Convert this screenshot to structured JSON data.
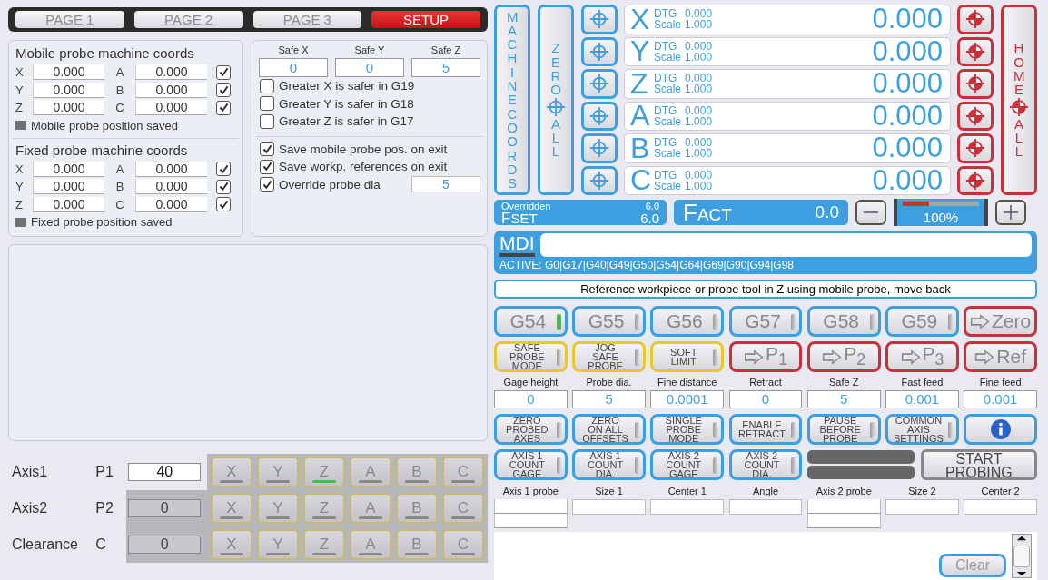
{
  "tabs": [
    {
      "label": "PAGE 1",
      "selected": false
    },
    {
      "label": "PAGE 2",
      "selected": false
    },
    {
      "label": "PAGE 3",
      "selected": false
    },
    {
      "label": "SETUP",
      "selected": true
    }
  ],
  "probe_coords": [
    {
      "title": "Mobile probe machine coords",
      "rows": [
        {
          "axis_1": "X",
          "value_1": "0.000",
          "axis_2": "A",
          "value_2": "0.000",
          "checked": true
        },
        {
          "axis_1": "Y",
          "value_1": "0.000",
          "axis_2": "B",
          "value_2": "0.000",
          "checked": true
        },
        {
          "axis_1": "Z",
          "value_1": "0.000",
          "axis_2": "C",
          "value_2": "0.000",
          "checked": true
        }
      ],
      "saved": {
        "label": "Mobile probe position saved",
        "on": false
      }
    },
    {
      "title": "Fixed probe machine coords",
      "rows": [
        {
          "axis_1": "X",
          "value_1": "0.000",
          "axis_2": "A",
          "value_2": "0.000",
          "checked": true
        },
        {
          "axis_1": "Y",
          "value_1": "0.000",
          "axis_2": "B",
          "value_2": "0.000",
          "checked": true
        },
        {
          "axis_1": "Z",
          "value_1": "0.000",
          "axis_2": "C",
          "value_2": "0.000",
          "checked": true
        }
      ],
      "saved": {
        "label": "Fixed probe position saved",
        "on": false
      }
    }
  ],
  "safe_positions": {
    "fields": [
      {
        "label": "Safe X",
        "value": "0"
      },
      {
        "label": "Safe Y",
        "value": "0"
      },
      {
        "label": "Safe Z",
        "value": "5"
      }
    ],
    "options": [
      {
        "label": "Greater X is safer in G19",
        "checked": false
      },
      {
        "label": "Greater Y is safer in G18",
        "checked": false
      },
      {
        "label": "Greater Z is safer in G17",
        "checked": false
      }
    ],
    "exit_options": [
      {
        "label": "Save mobile probe pos. on exit",
        "checked": true
      },
      {
        "label": "Save workp. references on exit",
        "checked": true
      },
      {
        "label": "Override probe dia",
        "checked": true,
        "value": "5"
      }
    ]
  },
  "axis_selection": [
    {
      "label": "Axis1",
      "param": "P1",
      "value": "40",
      "enabled": true,
      "axes": [
        {
          "letter": "X",
          "selected": false
        },
        {
          "letter": "Y",
          "selected": false
        },
        {
          "letter": "Z",
          "selected": true
        },
        {
          "letter": "A",
          "selected": false
        },
        {
          "letter": "B",
          "selected": false
        },
        {
          "letter": "C",
          "selected": false
        }
      ]
    },
    {
      "label": "Axis2",
      "param": "P2",
      "value": "0",
      "enabled": false,
      "axes": [
        {
          "letter": "X",
          "selected": false
        },
        {
          "letter": "Y",
          "selected": false
        },
        {
          "letter": "Z",
          "selected": false
        },
        {
          "letter": "A",
          "selected": false
        },
        {
          "letter": "B",
          "selected": false
        },
        {
          "letter": "C",
          "selected": false
        }
      ]
    },
    {
      "label": "Clearance",
      "param": "C",
      "value": "0",
      "enabled": false,
      "axes": [
        {
          "letter": "X",
          "selected": false
        },
        {
          "letter": "Y",
          "selected": false
        },
        {
          "letter": "Z",
          "selected": false
        },
        {
          "letter": "A",
          "selected": false
        },
        {
          "letter": "B",
          "selected": false
        },
        {
          "letter": "C",
          "selected": false
        }
      ]
    }
  ],
  "dro": {
    "machine_coords_button": "MACHINE COORDS",
    "zero_all": {
      "top": "ZERO",
      "bottom": "ALL"
    },
    "home_all": {
      "top": "HOME",
      "bottom": "ALL"
    },
    "axes": [
      {
        "letter": "X",
        "dtg_label": "DTG",
        "dtg": "0.000",
        "scale_label": "Scale",
        "scale": "1.000",
        "value": "0.000"
      },
      {
        "letter": "Y",
        "dtg_label": "DTG",
        "dtg": "0.000",
        "scale_label": "Scale",
        "scale": "1.000",
        "value": "0.000"
      },
      {
        "letter": "Z",
        "dtg_label": "DTG",
        "dtg": "0.000",
        "scale_label": "Scale",
        "scale": "1.000",
        "value": "0.000"
      },
      {
        "letter": "A",
        "dtg_label": "DTG",
        "dtg": "0.000",
        "scale_label": "Scale",
        "scale": "1.000",
        "value": "0.000"
      },
      {
        "letter": "B",
        "dtg_label": "DTG",
        "dtg": "0.000",
        "scale_label": "Scale",
        "scale": "1.000",
        "value": "0.000"
      },
      {
        "letter": "C",
        "dtg_label": "DTG",
        "dtg": "0.000",
        "scale_label": "Scale",
        "scale": "1.000",
        "value": "0.000"
      }
    ]
  },
  "feed": {
    "overridden_label": "Overridden",
    "overridden": "6.0",
    "set_label": "FSET",
    "set": "6.0",
    "actual_label": "FACT",
    "actual": "0.0",
    "override": {
      "level": 0.35,
      "reading": "100%"
    }
  },
  "mdi": {
    "label": "MDI",
    "active": "ACTIVE: G0|G17|G40|G49|G50|G54|G64|G69|G90|G94|G98"
  },
  "status": "Reference workpiece or probe tool in Z using mobile probe, move back",
  "work_offsets": [
    {
      "label": "G54",
      "selected": true
    },
    {
      "label": "G55",
      "selected": false
    },
    {
      "label": "G56",
      "selected": false
    },
    {
      "label": "G57",
      "selected": false
    },
    {
      "label": "G58",
      "selected": false
    },
    {
      "label": "G59",
      "selected": false
    }
  ],
  "goto_zero": "Zero",
  "probe_modes": [
    {
      "lines": [
        "SAFE",
        "PROBE",
        "MODE"
      ],
      "on": false
    },
    {
      "lines": [
        "JOG",
        "SAFE",
        "PROBE"
      ],
      "on": false
    },
    {
      "lines": [
        "SOFT",
        "LIMIT"
      ],
      "on": false
    }
  ],
  "goto_buttons": [
    "P$_{1}$",
    "P$_{2}$",
    "P$_{3}$",
    "Ref"
  ],
  "parameters": [
    {
      "label": "Gage height",
      "value": "0"
    },
    {
      "label": "Probe dia.",
      "value": "5"
    },
    {
      "label": "Fine distance",
      "value": "0.0001"
    },
    {
      "label": "Retract",
      "value": "0"
    },
    {
      "label": "Safe Z",
      "value": "5"
    },
    {
      "label": "Fast feed",
      "value": "0.001"
    },
    {
      "label": "Fine feed",
      "value": "0.001"
    }
  ],
  "options": [
    {
      "lines": [
        "ZERO",
        "PROBED",
        "AXES"
      ],
      "on": false
    },
    {
      "lines": [
        "ZERO",
        "ON ALL",
        "OFFSETS"
      ],
      "on": false
    },
    {
      "lines": [
        "SINGLE",
        "PROBE",
        "MODE"
      ],
      "on": false
    },
    {
      "lines": [
        "ENABLE",
        "RETRACT"
      ],
      "on": false
    },
    {
      "lines": [
        "PAUSE",
        "BEFORE",
        "PROBE"
      ],
      "on": false
    },
    {
      "lines": [
        "COMMON",
        "AXIS",
        "SETTINGS"
      ],
      "on": false
    }
  ],
  "count_options": [
    {
      "lines": [
        "AXIS 1",
        "COUNT",
        "GAGE"
      ],
      "on": false
    },
    {
      "lines": [
        "AXIS 1",
        "COUNT",
        "DIA."
      ],
      "on": false
    },
    {
      "lines": [
        "AXIS 2",
        "COUNT",
        "GAGE"
      ],
      "on": false
    },
    {
      "lines": [
        "AXIS 2",
        "COUNT",
        "DIA."
      ],
      "on": false
    }
  ],
  "start_button": "START PROBING",
  "results": [
    {
      "label": "Axis 1 probe",
      "kind": "double"
    },
    {
      "label": "Size 1",
      "kind": "single"
    },
    {
      "label": "Center 1",
      "kind": "single"
    },
    {
      "label": "Angle",
      "kind": "single"
    },
    {
      "label": "Axis 2 probe",
      "kind": "double"
    },
    {
      "label": "Size 2",
      "kind": "single"
    },
    {
      "label": "Center 2",
      "kind": "single"
    }
  ],
  "log": {
    "clear_button": "Clear"
  }
}
